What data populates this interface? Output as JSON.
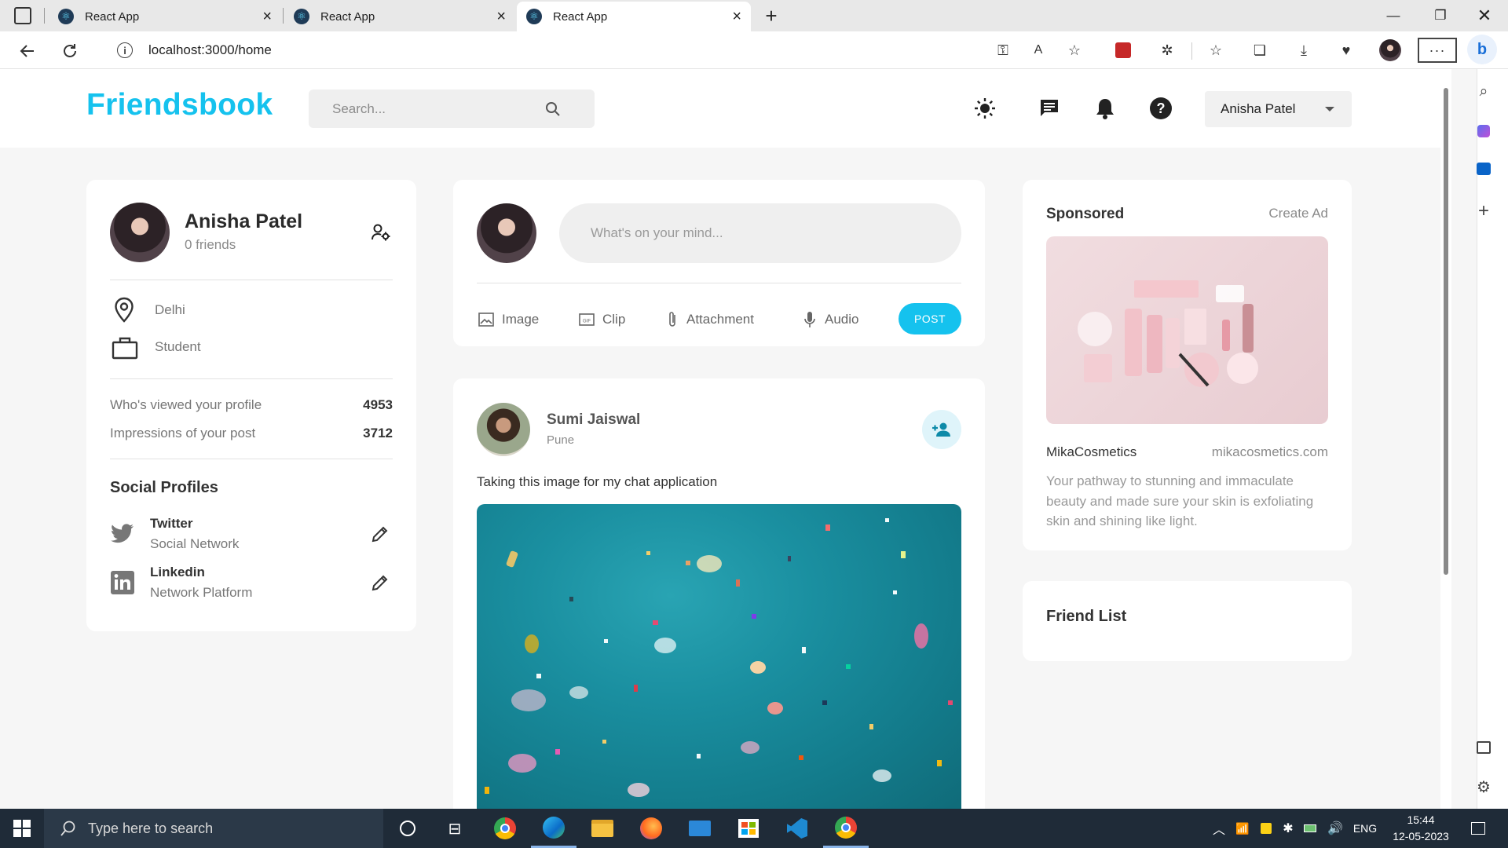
{
  "browser": {
    "tabs": [
      {
        "title": "React App",
        "active": false
      },
      {
        "title": "React App",
        "active": false
      },
      {
        "title": "React App",
        "active": true
      }
    ],
    "url": "localhost:3000/home"
  },
  "app": {
    "logo": "Friendsbook",
    "search_placeholder": "Search...",
    "user_menu": "Anisha Patel",
    "accent_color": "#15c2ee"
  },
  "profile": {
    "name": "Anisha Patel",
    "friends": "0 friends",
    "location": "Delhi",
    "occupation": "Student",
    "stats": [
      {
        "label": "Who's viewed your profile",
        "value": "4953"
      },
      {
        "label": "Impressions of your post",
        "value": "3712"
      }
    ],
    "social_heading": "Social Profiles",
    "socials": [
      {
        "name": "Twitter",
        "sub": "Social Network"
      },
      {
        "name": "Linkedin",
        "sub": "Network Platform"
      }
    ]
  },
  "composer": {
    "placeholder": "What's on your mind...",
    "actions": [
      "Image",
      "Clip",
      "Attachment",
      "Audio"
    ],
    "post_label": "POST"
  },
  "post": {
    "author": "Sumi Jaiswal",
    "location": "Pune",
    "text": "Taking this image for my chat application"
  },
  "sponsored": {
    "heading": "Sponsored",
    "create_ad": "Create Ad",
    "brand": "MikaCosmetics",
    "site": "mikacosmetics.com",
    "description": "Your pathway to stunning and immaculate beauty and made sure your skin is exfoliating skin and shining like light."
  },
  "friend_list": {
    "heading": "Friend List"
  },
  "taskbar": {
    "search_placeholder": "Type here to search",
    "language": "ENG",
    "time": "15:44",
    "date": "12-05-2023"
  }
}
